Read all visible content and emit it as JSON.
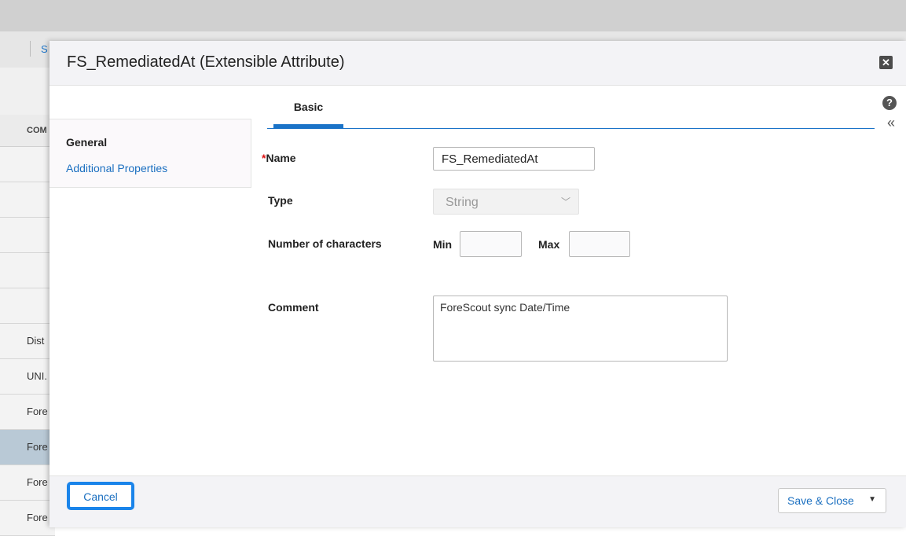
{
  "background": {
    "top_link": "S",
    "column_header": "COM",
    "rows": [
      "",
      "",
      "",
      "",
      "",
      "Dist",
      "UNI.",
      "Fore",
      "Fore",
      "Fore",
      "Fore"
    ]
  },
  "dialog": {
    "title": "FS_RemediatedAt (Extensible Attribute)",
    "close_symbol": "✕"
  },
  "sidebar": {
    "items": [
      {
        "label": "General"
      },
      {
        "label": "Additional Properties"
      }
    ]
  },
  "tabs": [
    {
      "label": "Basic",
      "active": true
    }
  ],
  "form": {
    "name_required_marker": "*",
    "name_label": "Name",
    "name_value": "FS_RemediatedAt",
    "type_label": "Type",
    "type_value": "String",
    "chars_label": "Number of characters",
    "min_label": "Min",
    "min_value": "",
    "max_label": "Max",
    "max_value": "",
    "comment_label": "Comment",
    "comment_value": "ForeScout sync Date/Time"
  },
  "footer": {
    "cancel_label": "Cancel",
    "save_label": "Save & Close"
  },
  "colors": {
    "accent": "#1a73c8",
    "focus_ring": "#1a84ea",
    "required": "#dd1111"
  }
}
